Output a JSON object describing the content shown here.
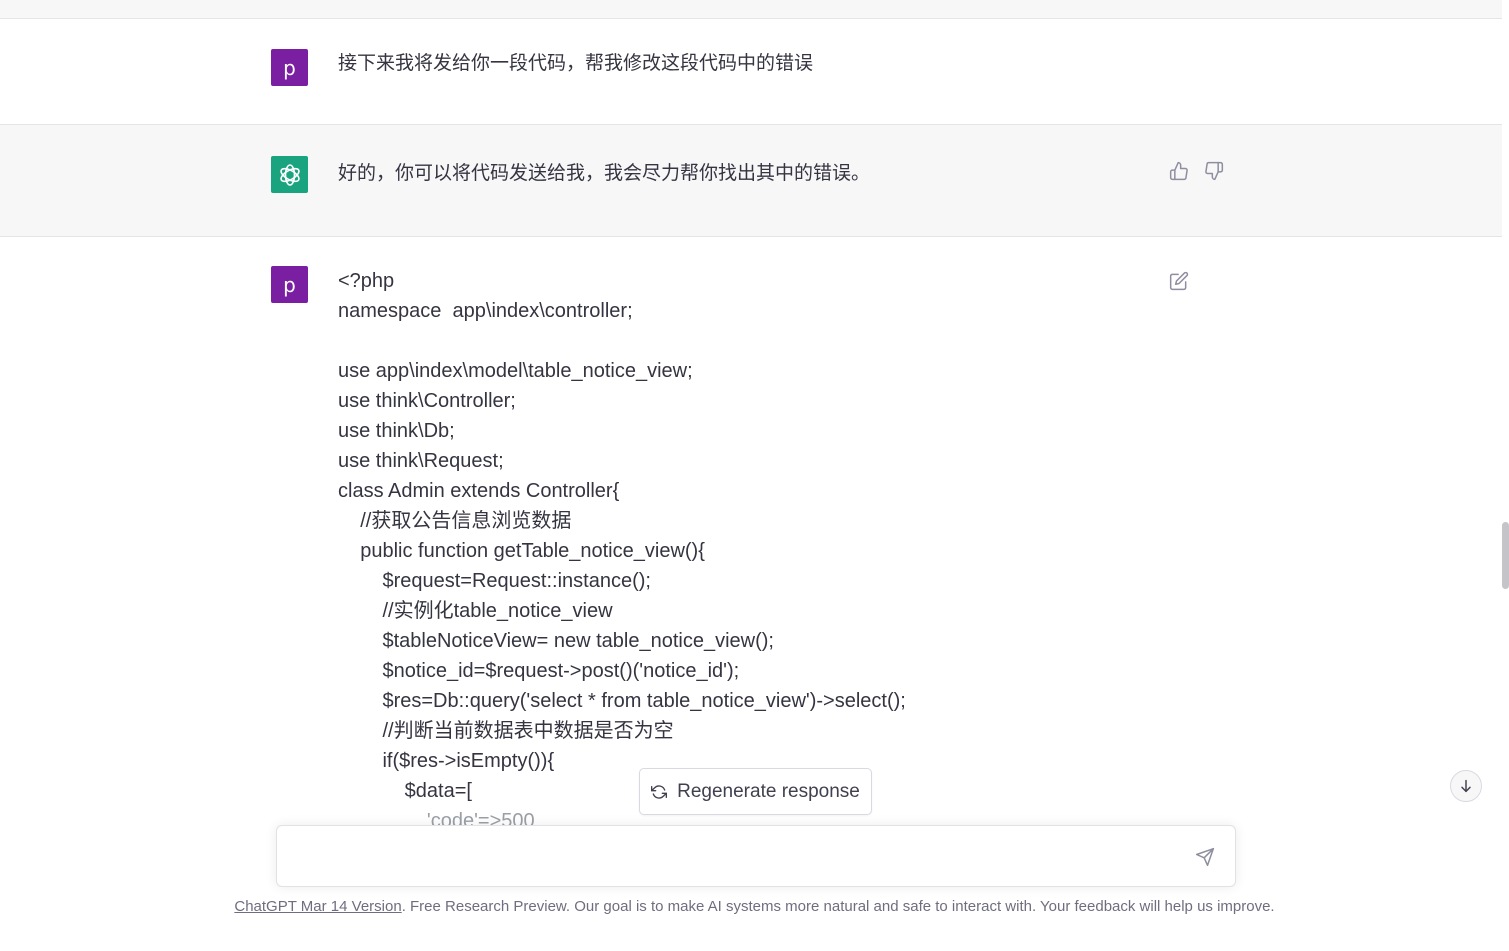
{
  "conversation": {
    "message1": {
      "avatar": "p",
      "text": "接下来我将发给你一段代码，帮我修改这段代码中的错误"
    },
    "message2": {
      "avatar_icon": "openai-logo-icon",
      "text": "好的，你可以将代码发送给我，我会尽力帮你找出其中的错误。"
    },
    "message3": {
      "avatar": "p",
      "code_lines": [
        "<?php",
        "namespace  app\\index\\controller;",
        "",
        "use app\\index\\model\\table_notice_view;",
        "use think\\Controller;",
        "use think\\Db;",
        "use think\\Request;",
        "class Admin extends Controller{",
        "    //获取公告信息浏览数据",
        "    public function getTable_notice_view(){",
        "        $request=Request::instance();",
        "        //实例化table_notice_view",
        "        $tableNoticeView= new table_notice_view();",
        "        $notice_id=$request->post()('notice_id');",
        "        $res=Db::query('select * from table_notice_view')->select();",
        "        //判断当前数据表中数据是否为空",
        "        if($res->isEmpty()){",
        "            $data=[",
        "                'code'=>500"
      ]
    }
  },
  "actions": {
    "regenerate_label": "Regenerate response",
    "thumbs_up_icon": "thumbs-up-icon",
    "thumbs_down_icon": "thumbs-down-icon",
    "edit_icon": "edit-icon"
  },
  "composer": {
    "placeholder": "",
    "value": ""
  },
  "footer": {
    "link": "ChatGPT Mar 14 Version",
    "text": ". Free Research Preview. Our goal is to make AI systems more natural and safe to interact with. Your feedback will help us improve."
  },
  "colors": {
    "user_avatar": "#7b1fa2",
    "gpt_avatar": "#19a37f",
    "assistant_bg": "#f7f7f8"
  }
}
